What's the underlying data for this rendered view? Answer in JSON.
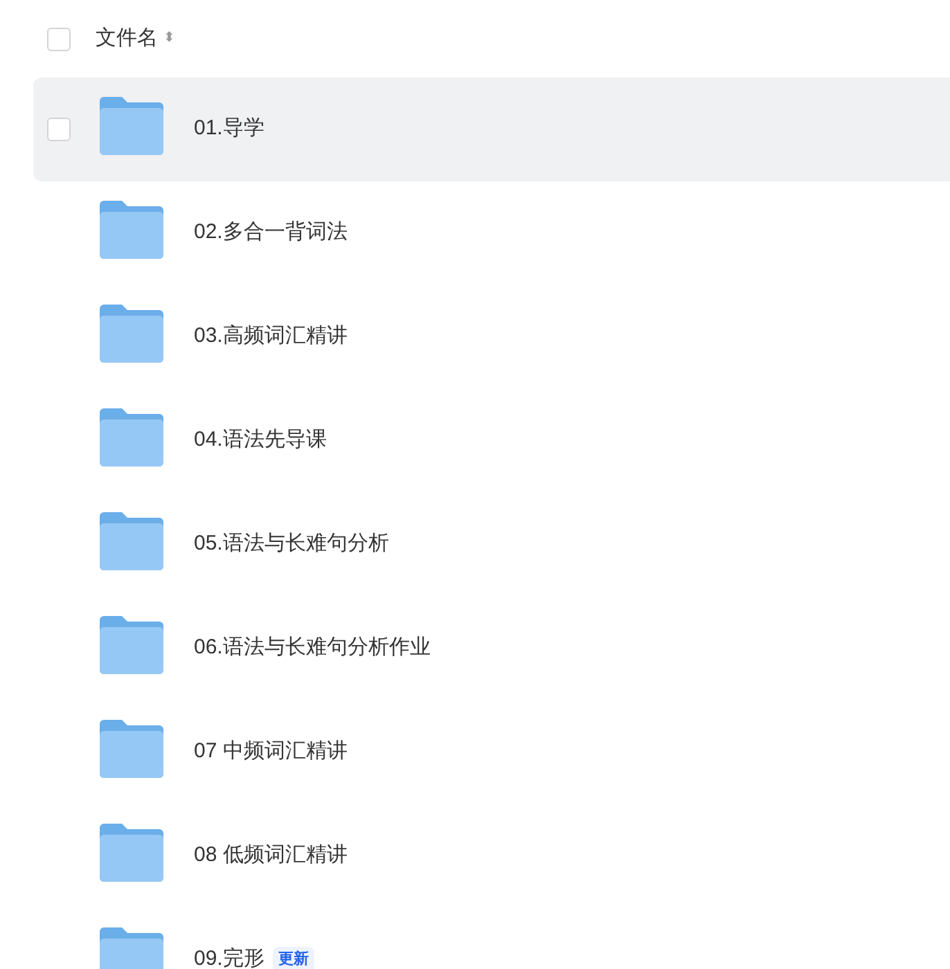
{
  "header": {
    "checked": false,
    "column": "文件名",
    "sort_icon": "⬍"
  },
  "files": [
    {
      "name": "01.导学",
      "hovered": true,
      "checked": false
    },
    {
      "name": "02.多合一背词法",
      "hovered": false,
      "checked": false
    },
    {
      "name": "03.高频词汇精讲",
      "hovered": false,
      "checked": false
    },
    {
      "name": "04.语法先导课",
      "hovered": false,
      "checked": false
    },
    {
      "name": "05.语法与长难句分析",
      "hovered": false,
      "checked": false
    },
    {
      "name": "06.语法与长难句分析作业",
      "hovered": false,
      "checked": false
    },
    {
      "name": "07 中频词汇精讲",
      "hovered": false,
      "checked": false
    },
    {
      "name": "08 低频词汇精讲",
      "hovered": false,
      "checked": false
    },
    {
      "name": "09.完形",
      "hovered": false,
      "checked": false,
      "badge": "更新"
    }
  ]
}
